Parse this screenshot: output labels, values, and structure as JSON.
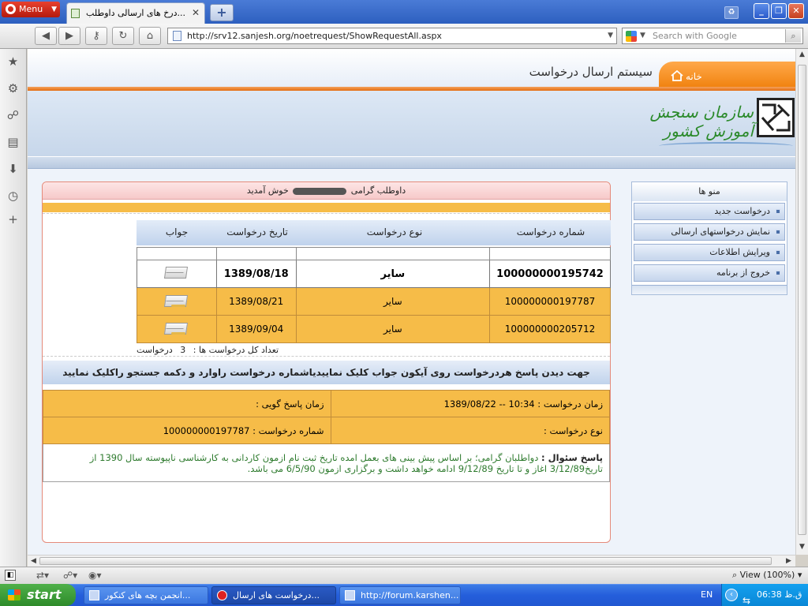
{
  "browser": {
    "menu_label": "Menu",
    "tab_title": "...درخ های ارسالی داوطلب",
    "url": "http://srv12.sanjesh.org/noetrequest/ShowRequestAll.aspx",
    "search_placeholder": "Search with Google",
    "zoom_label": "View (100%)"
  },
  "site": {
    "home_label": "خانه",
    "title": "سیستم ارسال درخواست",
    "logo_text": "سازمان سنجش آموزش کشور"
  },
  "welcome": {
    "prefix": "داوطلب گرامی",
    "suffix": "خوش آمدید"
  },
  "requests": {
    "headers": {
      "number": "شماره درخواست",
      "type": "نوع درخواست",
      "date": "تاریخ درخواست",
      "answer": "جواب"
    },
    "rows": [
      {
        "number": "100000000195742",
        "type": "سایر",
        "date": "1389/08/18"
      },
      {
        "number": "100000000197787",
        "type": "سایر",
        "date": "1389/08/21"
      },
      {
        "number": "100000000205712",
        "type": "سایر",
        "date": "1389/09/04"
      }
    ],
    "count_label": "تعداد کل درخواست ها :",
    "count_value": "3",
    "count_unit": "درخواست"
  },
  "hint": "جهت دیدن پاسخ هردرخواست روی آیکون جواب کلیک نماییدیاشماره درخواست راوارد و دکمه جستجو راکلیک نمایید",
  "detail": {
    "request_time_label": "زمان درخواست :",
    "request_time_value": "10:34 -- 1389/08/22",
    "response_time_label": "زمان پاسخ گویی :",
    "request_type_label": "نوع درخواست :",
    "request_number_label": "شماره درخواست :",
    "request_number_value": "100000000197787",
    "answer_label": "پاسخ سئوال :",
    "answer_text": "دواطلبان گرامی؛ بر اساس پیش بینی های بعمل امده تاریخ ثبت نام ازمون کاردانی به کارشناسی ناپیوسته سال 1390 از تاریخ3/12/89 اغاز و تا تاریخ 9/12/89 ادامه خواهد داشت و برگزاری ازمون 6/5/90 می باشد."
  },
  "menu": {
    "title": "منو ها",
    "items": [
      "درخواست جدید",
      "نمایش درخواستهای ارسالی",
      "ویرایش اطلاعات",
      "خروج از برنامه"
    ]
  },
  "taskbar": {
    "start": "start",
    "tasks": [
      "انجمن بچه های کنکور...",
      "درخواست های ارسال...",
      "http://forum.karshen..."
    ],
    "lang": "EN",
    "clock": "06:38 ق.ظ"
  }
}
